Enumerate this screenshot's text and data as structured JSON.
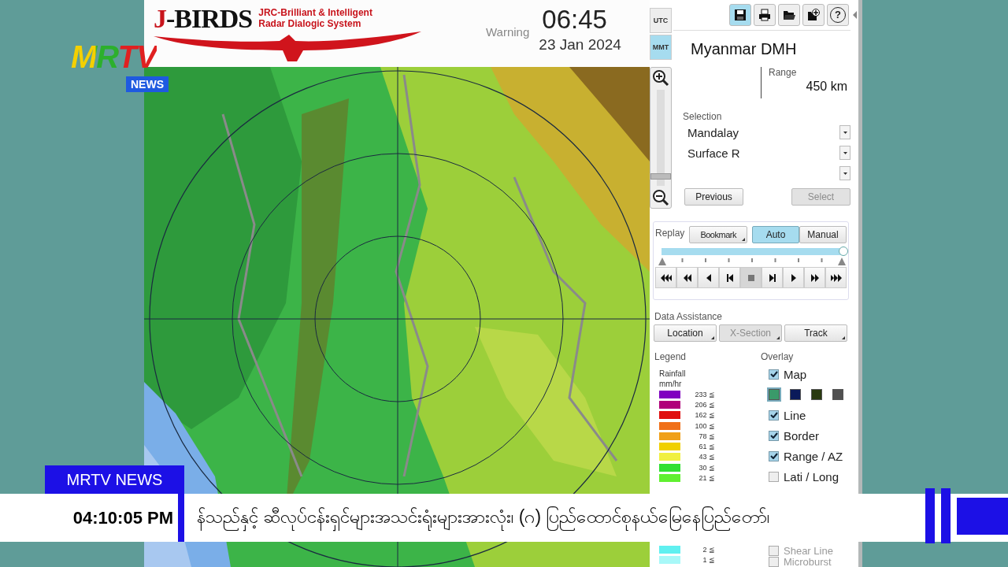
{
  "channel_logo": {
    "name": "MRTV",
    "badge": "NEWS"
  },
  "app": {
    "logo": {
      "title_initial": "J",
      "title_rest": "-BIRDS",
      "subtitle_lines": [
        "JRC-Brilliant & Intelligent",
        "Radar Dialogic System"
      ]
    },
    "warning": "Warning",
    "time": "06:45",
    "date": "23 Jan 2024",
    "time_zones": [
      {
        "label": "UTC",
        "selected": false
      },
      {
        "label": "MMT",
        "selected": true
      }
    ],
    "toolbar": [
      {
        "kind": "save",
        "selected": true
      },
      {
        "kind": "print",
        "selected": false
      },
      {
        "kind": "open",
        "selected": false
      },
      {
        "kind": "add",
        "selected": false
      },
      {
        "kind": "help",
        "glyph": "?",
        "selected": false
      }
    ],
    "zoom": {
      "level": 0.1
    },
    "site": "Myanmar DMH",
    "range": {
      "label": "Range",
      "value": "450 km"
    },
    "selection": {
      "label": "Selection",
      "dropdowns": [
        {
          "kind": "filled",
          "value": "Mandalay"
        },
        {
          "kind": "filled",
          "value": "Surface R"
        },
        {
          "kind": "empty"
        }
      ]
    },
    "nav_buttons": [
      {
        "label": "Previous",
        "disabled": false
      },
      {
        "label": "Select",
        "disabled": true
      }
    ],
    "replay": {
      "label": "Replay",
      "bookmark": "Bookmark",
      "modes": [
        {
          "label": "Auto",
          "selected": true
        },
        {
          "label": "Manual",
          "selected": false
        }
      ],
      "level": 1.0,
      "controls": [
        {
          "kind": "first",
          "selected": false
        },
        {
          "kind": "fast_back",
          "selected": false
        },
        {
          "kind": "back",
          "selected": false
        },
        {
          "kind": "step_back",
          "selected": false
        },
        {
          "kind": "stop",
          "selected": true
        },
        {
          "kind": "step_forward",
          "selected": false
        },
        {
          "kind": "play",
          "selected": false
        },
        {
          "kind": "fast_forward",
          "selected": false
        },
        {
          "kind": "last",
          "selected": false
        }
      ]
    },
    "data_assistance": {
      "label": "Data Assistance",
      "buttons": [
        {
          "label": "Location",
          "disabled": false
        },
        {
          "label": "X-Section",
          "disabled": true
        },
        {
          "label": "Track",
          "disabled": false
        }
      ]
    },
    "legend": {
      "label": "Legend",
      "title_lines": [
        "Rainfall",
        "mm/hr"
      ],
      "upper": [
        {
          "value": "233 ≦",
          "color": "#8000c0"
        },
        {
          "value": "206 ≦",
          "color": "#b0007a"
        },
        {
          "value": "162 ≦",
          "color": "#e01010"
        },
        {
          "value": "100 ≦",
          "color": "#f07018"
        },
        {
          "value": "78 ≦",
          "color": "#f0a018"
        },
        {
          "value": "61 ≦",
          "color": "#f0d000"
        },
        {
          "value": "43 ≦",
          "color": "#f0f040"
        },
        {
          "value": "30 ≦",
          "color": "#30e030"
        },
        {
          "value": "21 ≦",
          "color": "#60f030"
        }
      ],
      "lower": [
        {
          "value": "2 ≦",
          "color": "#60f0f0"
        },
        {
          "value": "1 ≦",
          "color": "#a8f8f8"
        }
      ]
    },
    "overlay": {
      "label": "Overlay",
      "upper": [
        {
          "kind": "check",
          "label": "Map",
          "checked": true
        },
        {
          "kind": "swatches",
          "swatches": [
            {
              "color": "#3a9a6a",
              "selected": true
            },
            {
              "color": "#0a1a5a",
              "selected": false
            },
            {
              "color": "#2a3a10",
              "selected": false
            },
            {
              "color": "#505050",
              "selected": false
            }
          ]
        },
        {
          "kind": "check",
          "label": "Line",
          "checked": true
        },
        {
          "kind": "check",
          "label": "Border",
          "checked": true
        },
        {
          "kind": "check",
          "label": "Range / AZ",
          "checked": true
        },
        {
          "kind": "check",
          "label": "Lati / Long",
          "checked": false
        }
      ],
      "lower": [
        {
          "kind": "check",
          "label": "Shear Line",
          "checked": false
        },
        {
          "kind": "check",
          "label": "Microburst",
          "checked": false
        }
      ]
    }
  },
  "ticker": {
    "tab": "MRTV NEWS",
    "time": "04:10:05  PM",
    "text": "န်သည်နှင့် ဆီလုပ်ငန်းရှင်များအသင်းရုံးများအားလုံး၊  (ဂ) ပြည်ထောင်စုနယ်မြေနေပြည်တော်၊"
  }
}
